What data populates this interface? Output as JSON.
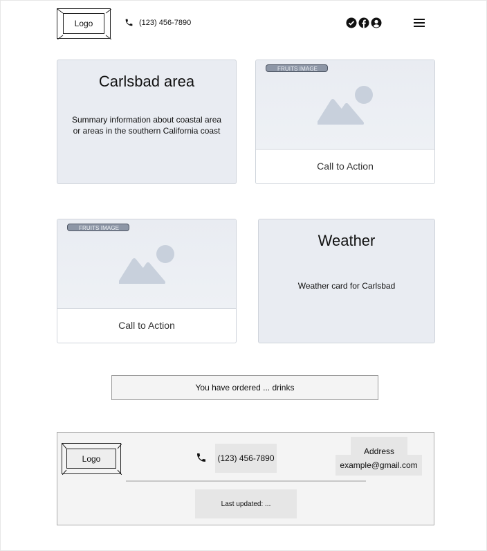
{
  "header": {
    "logo_label": "Logo",
    "phone": "(123) 456-7890",
    "social_icons": [
      "check-circle-icon",
      "facebook-icon",
      "user-circle-icon"
    ],
    "menu_icon": "hamburger-menu-icon"
  },
  "cards": {
    "area": {
      "title": "Carlsbad area",
      "text": "Summary information about coastal area or areas in the southern California coast"
    },
    "image_card_1": {
      "tag": "FRUITS IMAGE",
      "cta": "Call to Action"
    },
    "image_card_2": {
      "tag": "FRUITS IMAGE",
      "cta": "Call to Action"
    },
    "weather": {
      "title": "Weather",
      "text": "Weather card for Carlsbad"
    }
  },
  "order": {
    "text": "You have ordered ... drinks"
  },
  "footer": {
    "logo_label": "Logo",
    "phone": "(123) 456-7890",
    "address": "Address",
    "email": "example@gmail.com",
    "updated": "Last updated: ..."
  },
  "colors": {
    "card_bg": "#e9ecf2",
    "tag_bg": "#8d96a6",
    "footer_bg": "#f4f4f4"
  }
}
